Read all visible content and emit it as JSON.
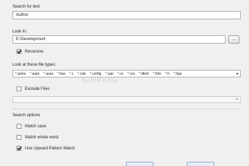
{
  "search": {
    "label": "Search for text:",
    "value": "Author"
  },
  "look_in": {
    "label": "Look in:",
    "value": "E:\\Development",
    "browse_label": "...",
    "recursive_label": "Recursive",
    "recursive_checked": true
  },
  "file_types": {
    "label": "Look at these file types:",
    "items": [
      "*.asmx",
      "*.aspx",
      "*.asax",
      "*.bas",
      "*.c",
      "*.cab",
      "*.config",
      "*.cpp",
      "*.cs",
      "*.css",
      "*.dbml",
      "*.htm",
      "*.h",
      "*.hpp"
    ]
  },
  "exclude": {
    "label": "Exclude Files",
    "checked": false,
    "value": ""
  },
  "options": {
    "label": "Search options",
    "match_case": {
      "label": "Match case",
      "checked": false
    },
    "match_whole_word": {
      "label": "Match whole word",
      "checked": false
    },
    "use_upward_pattern": {
      "label": "Use Upward Pattern Match",
      "checked": true
    }
  }
}
